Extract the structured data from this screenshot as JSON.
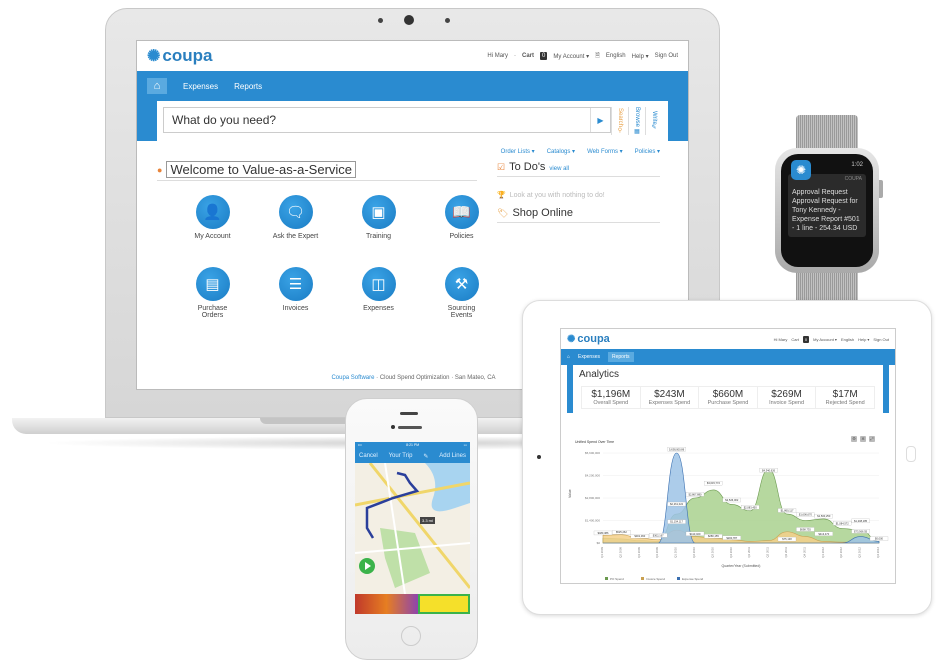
{
  "laptop": {
    "brand": "coupa",
    "user_menu": {
      "greeting": "Hi Mary",
      "cart_label": "Cart",
      "cart_count": "0",
      "my_account": "My Account ▾",
      "language": "English",
      "help": "Help ▾",
      "sign_out": "Sign Out"
    },
    "nav": {
      "home_icon": "home-icon",
      "tabs": [
        "Expenses",
        "Reports"
      ]
    },
    "search": {
      "placeholder": "What do you need?",
      "go_icon": "play-arrow-icon",
      "side_tabs": [
        {
          "label": "Search",
          "icon": "search-icon",
          "color": "#e8a24a"
        },
        {
          "label": "Browse",
          "icon": "grid-icon",
          "color": "#2a8bd0"
        },
        {
          "label": "Write",
          "icon": "pencil-icon",
          "color": "#2a8bd0"
        }
      ]
    },
    "quick_links": [
      "Order Lists ▾",
      "Catalogs ▾",
      "Web Forms ▾",
      "Policies ▾"
    ],
    "welcome_title": "Welcome to Value-as-a-Service",
    "tiles": [
      {
        "label": "My Account",
        "icon": "user-icon",
        "glyph": "👤"
      },
      {
        "label": "Ask the Expert",
        "icon": "expert-icon",
        "glyph": "💬"
      },
      {
        "label": "Training",
        "icon": "training-icon",
        "glyph": "📋"
      },
      {
        "label": "Policies",
        "icon": "book-icon",
        "glyph": "📖"
      },
      {
        "label": "Purchase Orders",
        "icon": "document-icon",
        "glyph": "📄"
      },
      {
        "label": "Invoices",
        "icon": "invoice-icon",
        "glyph": "🧾"
      },
      {
        "label": "Expenses",
        "icon": "wallet-icon",
        "glyph": "👛"
      },
      {
        "label": "Sourcing Events",
        "icon": "gavel-icon",
        "glyph": "🔨"
      }
    ],
    "todo": {
      "title": "To Do's",
      "view_all": "view all",
      "empty_message": "Look at you with nothing to do!",
      "shop_title": "Shop Online"
    },
    "footer": {
      "company": "Coupa Software",
      "tagline": "Cloud Spend Optimization",
      "location": "San Mateo, CA"
    }
  },
  "watch": {
    "time": "1:02",
    "app_name": "COUPA",
    "notification_title": "Approval Request",
    "notification_body": "Approval Request for Tony Kennedy - Expense Report #501 - 1 line - 254.34 USD"
  },
  "tablet": {
    "brand": "coupa",
    "user_menu": [
      "Hi Mary",
      "Cart",
      "My Account ▾",
      "English",
      "Help ▾",
      "Sign Out"
    ],
    "nav_tabs": [
      "Expenses",
      "Reports"
    ],
    "active_tab": "Reports",
    "page_title": "Analytics",
    "kpis": [
      {
        "value": "$1,196M",
        "label": "Overall Spend"
      },
      {
        "value": "$243M",
        "label": "Expenses Spend"
      },
      {
        "value": "$660M",
        "label": "Purchase Spend"
      },
      {
        "value": "$269M",
        "label": "Invoice Spend"
      },
      {
        "value": "$17M",
        "label": "Rejected Spend"
      }
    ],
    "chart_tools": [
      "gear-icon",
      "settings-icon",
      "expand-icon"
    ]
  },
  "chart_data": {
    "type": "area",
    "title": "Unified Spend Over Time",
    "xlabel": "Quarter/Year (Submitted)",
    "ylabel": "Value",
    "ylim": [
      0,
      5600000
    ],
    "y_ticks": [
      "$0",
      "$1,400,000",
      "$2,800,000",
      "$4,200,000",
      "$5,600,000"
    ],
    "categories": [
      "Q1 2009",
      "Q2 2009",
      "Q3 2009",
      "Q4 2009",
      "Q1 2010",
      "Q2 2010",
      "Q3 2010",
      "Q4 2010",
      "Q1 2011",
      "Q2 2011",
      "Q3 2011",
      "Q4 2011",
      "Q1 2012",
      "Q2 2012",
      "Q3 2012",
      "Q4 2012"
    ],
    "legend_position": "bottom-left",
    "series": [
      {
        "name": "PO Spend",
        "color": "#a9d18e",
        "values": [
          300000,
          250000,
          150000,
          100000,
          1800000,
          2800000,
          3300000,
          2400000,
          2000000,
          4600000,
          1800000,
          1400000,
          1500000,
          900000,
          800000,
          100000
        ]
      },
      {
        "name": "Invoice Spend",
        "color": "#f5d08a",
        "values": [
          480000,
          520000,
          300000,
          200000,
          800000,
          400000,
          300000,
          200000,
          100000,
          150000,
          700000,
          400000,
          100000,
          50000,
          50000,
          20000
        ]
      },
      {
        "name": "Expense Spend",
        "color": "#9dc3e6",
        "values": [
          0,
          0,
          0,
          0,
          5600000,
          0,
          0,
          0,
          0,
          0,
          0,
          0,
          0,
          0,
          400000,
          100000
        ]
      }
    ],
    "data_labels": [
      "$480,386",
      "$525,262",
      "$301,360",
      "$302,167",
      "5,638,000.86",
      "$2,261,022",
      "$2,867,880",
      "$1,154,117",
      "$413,029",
      "$3,615,772",
      "$2,526,002",
      "$2,083,450",
      "$280,155",
      "$200,787",
      "$4,340,626",
      "$1,860,117",
      "$1,606,670",
      "$1,500,250",
      "$75,138",
      "$698,735",
      "$413,470",
      "$1,084,572",
      "$1,208,185",
      "$73,566.55",
      "$0,000"
    ]
  },
  "phone": {
    "status_time": "8:21 PM",
    "nav_cancel": "Cancel",
    "nav_title": "Your Trip",
    "nav_add": "Add Lines",
    "distance_badge": "3.3 mi"
  }
}
